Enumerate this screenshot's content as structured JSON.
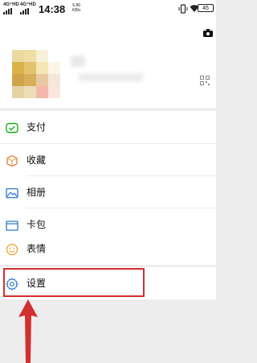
{
  "status_bar": {
    "signal_1": "4G⁺HD",
    "signal_2": "4G⁺HD",
    "time": "14:38",
    "net_speed_value": "6.80",
    "net_speed_unit": "KB/s",
    "battery": "45"
  },
  "menu": {
    "items": [
      {
        "label": "支付",
        "icon": "payment-icon"
      },
      {
        "label": "收藏",
        "icon": "favorites-icon"
      },
      {
        "label": "相册",
        "icon": "album-icon"
      },
      {
        "label": "卡包",
        "icon": "card-wallet-icon"
      },
      {
        "label": "表情",
        "icon": "emoji-icon"
      },
      {
        "label": "设置",
        "icon": "settings-icon"
      }
    ]
  },
  "colors": {
    "highlight": "#d32f2f",
    "payment_green": "#1aad19",
    "icon_blue": "#2d77c7",
    "emoji_orange": "#f0a030"
  }
}
